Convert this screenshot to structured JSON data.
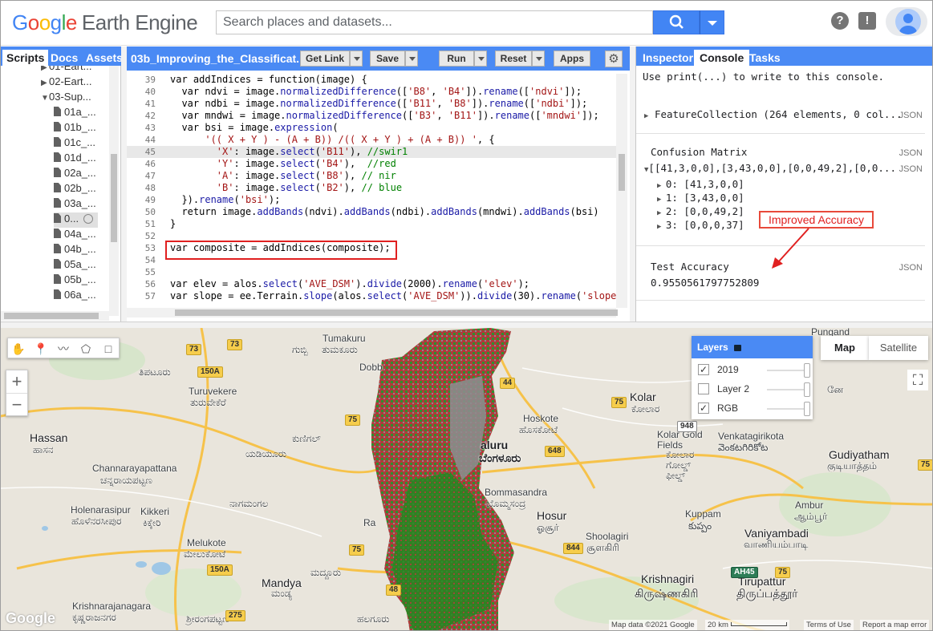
{
  "header": {
    "logo_google": [
      "G",
      "o",
      "o",
      "g",
      "l",
      "e"
    ],
    "logo_product": "Earth Engine",
    "search_placeholder": "Search places and datasets..."
  },
  "left_panel": {
    "tabs": [
      "Scripts",
      "Docs",
      "Assets"
    ],
    "tree": [
      {
        "label": "01-Eart...",
        "type": "folder",
        "expanded": false
      },
      {
        "label": "02-Eart...",
        "type": "folder",
        "expanded": false
      },
      {
        "label": "03-Sup...",
        "type": "folder",
        "expanded": true
      },
      {
        "label": "01a_...",
        "type": "file"
      },
      {
        "label": "01b_...",
        "type": "file"
      },
      {
        "label": "01c_...",
        "type": "file"
      },
      {
        "label": "01d_...",
        "type": "file"
      },
      {
        "label": "02a_...",
        "type": "file"
      },
      {
        "label": "02b_...",
        "type": "file"
      },
      {
        "label": "03a_...",
        "type": "file"
      },
      {
        "label": "0...",
        "type": "file",
        "selected": true
      },
      {
        "label": "04a_...",
        "type": "file"
      },
      {
        "label": "04b_...",
        "type": "file"
      },
      {
        "label": "05a_...",
        "type": "file"
      },
      {
        "label": "05b_...",
        "type": "file"
      },
      {
        "label": "06a_...",
        "type": "file"
      }
    ]
  },
  "editor": {
    "title": "03b_Improving_the_Classificat...",
    "buttons": {
      "get_link": "Get Link",
      "save": "Save",
      "run": "Run",
      "reset": "Reset",
      "apps": "Apps"
    },
    "lines": [
      {
        "n": "39",
        "html": "<span class=\"kw\">var</span> addIndices = <span class=\"kw\">function</span>(image) {"
      },
      {
        "n": "40",
        "html": "  <span class=\"kw\">var</span> ndvi = image.<span class=\"fn\">normalizedDifference</span>([<span class=\"str\">'B8'</span>, <span class=\"str\">'B4'</span>]).<span class=\"fn\">rename</span>([<span class=\"str\">'ndvi'</span>]);"
      },
      {
        "n": "41",
        "html": "  <span class=\"kw\">var</span> ndbi = image.<span class=\"fn\">normalizedDifference</span>([<span class=\"str\">'B11'</span>, <span class=\"str\">'B8'</span>]).<span class=\"fn\">rename</span>([<span class=\"str\">'ndbi'</span>]);"
      },
      {
        "n": "42",
        "html": "  <span class=\"kw\">var</span> mndwi = image.<span class=\"fn\">normalizedDifference</span>([<span class=\"str\">'B3'</span>, <span class=\"str\">'B11'</span>]).<span class=\"fn\">rename</span>([<span class=\"str\">'mndwi'</span>]);"
      },
      {
        "n": "43",
        "html": "  <span class=\"kw\">var</span> bsi = image.<span class=\"fn\">expression</span>("
      },
      {
        "n": "44",
        "html": "      <span class=\"str\">'(( X + Y ) - (A + B)) /(( X + Y ) + (A + B)) '</span>, {"
      },
      {
        "n": "45",
        "html": "        <span class=\"str\">'X'</span>: image.<span class=\"fn\">select</span>(<span class=\"str\">'B11'</span>), <span class=\"cm\">//swir1</span>",
        "hl": true
      },
      {
        "n": "46",
        "html": "        <span class=\"str\">'Y'</span>: image.<span class=\"fn\">select</span>(<span class=\"str\">'B4'</span>),  <span class=\"cm\">//red</span>"
      },
      {
        "n": "47",
        "html": "        <span class=\"str\">'A'</span>: image.<span class=\"fn\">select</span>(<span class=\"str\">'B8'</span>), <span class=\"cm\">// nir</span>"
      },
      {
        "n": "48",
        "html": "        <span class=\"str\">'B'</span>: image.<span class=\"fn\">select</span>(<span class=\"str\">'B2'</span>), <span class=\"cm\">// blue</span>"
      },
      {
        "n": "49",
        "html": "  }).<span class=\"fn\">rename</span>(<span class=\"str\">'bsi'</span>);"
      },
      {
        "n": "50",
        "html": "  <span class=\"kw\">return</span> image.<span class=\"fn\">addBands</span>(ndvi).<span class=\"fn\">addBands</span>(ndbi).<span class=\"fn\">addBands</span>(mndwi).<span class=\"fn\">addBands</span>(bsi)"
      },
      {
        "n": "51",
        "html": "}"
      },
      {
        "n": "52",
        "html": ""
      },
      {
        "n": "53",
        "html": "<span class=\"kw\">var</span> composite = addIndices(composite);"
      },
      {
        "n": "54",
        "html": ""
      },
      {
        "n": "55",
        "html": ""
      },
      {
        "n": "56",
        "html": "<span class=\"kw\">var</span> elev = alos.<span class=\"fn\">select</span>(<span class=\"str\">'AVE_DSM'</span>).<span class=\"fn\">divide</span>(2000).<span class=\"fn\">rename</span>(<span class=\"str\">'elev'</span>);"
      },
      {
        "n": "57",
        "html": "<span class=\"kw\">var</span> slope = ee.Terrain.<span class=\"fn\">slope</span>(alos.<span class=\"fn\">select</span>(<span class=\"str\">'AVE_DSM'</span>)).<span class=\"fn\">divide</span>(30).<span class=\"fn\">rename</span>(<span class=\"str\">'slope'</span>"
      }
    ]
  },
  "console": {
    "tabs": [
      "Inspector",
      "Console",
      "Tasks"
    ],
    "hint": "Use print(...) to write to this console.",
    "json_label": "JSON",
    "feature_collection": "FeatureCollection (264 elements, 0 col...",
    "confusion_title": "Confusion Matrix",
    "confusion_summary": "[[41,3,0,0],[3,43,0,0],[0,0,49,2],[0,0...",
    "confusion_rows": [
      "0: [41,3,0,0]",
      "1: [3,43,0,0]",
      "2: [0,0,49,2]",
      "3: [0,0,0,37]"
    ],
    "accuracy_title": "Test Accuracy",
    "accuracy_value": "0.9550561797752809",
    "callout": "Improved Accuracy"
  },
  "map": {
    "layers_title": "Layers",
    "layers": [
      {
        "name": "2019",
        "checked": true
      },
      {
        "name": "Layer 2",
        "checked": false
      },
      {
        "name": "RGB",
        "checked": true
      }
    ],
    "map_types": [
      "Map",
      "Satellite"
    ],
    "places": [
      {
        "id": "tumakuru",
        "name": "Tumakuru",
        "native": "ತುಮಕೂರು"
      },
      {
        "id": "gubbi",
        "name": "ಗುಬ್ಬಿ"
      },
      {
        "id": "tiptur",
        "name": "ತಿಪಟೂರು"
      },
      {
        "id": "turuvekere",
        "name": "Turuvekere",
        "native": "ತುರುವೇಕೆರೆ"
      },
      {
        "id": "kunigal",
        "name": "ಕುಣಿಗಲ್"
      },
      {
        "id": "yadiyur",
        "name": "ಯಡಿಯೂರು"
      },
      {
        "id": "hassan",
        "name": "Hassan",
        "native": "ಹಾಸನ"
      },
      {
        "id": "channarayapatna",
        "name": "Channarayapattana",
        "native": "ಚನ್ನರಾಯಪಟ್ಟಣ"
      },
      {
        "id": "holenarasipur",
        "name": "Holenarasipur",
        "native": "ಹೊಳೆನರಸೀಪುರ"
      },
      {
        "id": "kikkeri",
        "name": "Kikkeri",
        "native": "ಕಿಕ್ಕೇರಿ"
      },
      {
        "id": "nagamangala",
        "name": "ನಾಗಮಂಗಲ"
      },
      {
        "id": "melukote",
        "name": "Melukote",
        "native": "ಮೇಲುಕೋಟೆ"
      },
      {
        "id": "maddur",
        "name": "ಮದ್ದೂರು"
      },
      {
        "id": "mandya",
        "name": "Mandya",
        "native": "ಮಂಡ್ಯ"
      },
      {
        "id": "krishnarajanagara",
        "name": "Krishnarajanagara",
        "native": "ಕೃಷ್ಣರಾಜನಗರ"
      },
      {
        "id": "srirangapatna",
        "name": "ಶ್ರೀರಂಗಪಟ್ಟಣ"
      },
      {
        "id": "halaguru",
        "name": "ಹಲಗೂರು"
      },
      {
        "id": "dobb",
        "name": "Dobb"
      },
      {
        "id": "bengaluru",
        "name": "aluru",
        "native": "ಬೆಂಗಳೂರು"
      },
      {
        "id": "hoskote",
        "name": "Hoskote",
        "native": "ಹೊಸಕೋಟೆ"
      },
      {
        "id": "bommasandra",
        "name": "Bommasandra",
        "native": "ಬೊಮ್ಮಸಂದ್ರ"
      },
      {
        "id": "hosur",
        "name": "Hosur",
        "native": "ஓசூர்"
      },
      {
        "id": "shoolagiri",
        "name": "Shoolagiri",
        "native": "சூளகிரி"
      },
      {
        "id": "ra",
        "name": "Ra"
      },
      {
        "id": "kolar",
        "name": "Kolar",
        "native": "ಕೋಲಾರ"
      },
      {
        "id": "kolargold",
        "name": "Kolar Gold Fields",
        "native": "ಕೋಲಾರ ಗೋಲ್ಡ್ ಫೀಲ್ಡ್"
      },
      {
        "id": "venkatagiri",
        "name": "Venkatagirikota",
        "native": "వెంకటగిరికోట"
      },
      {
        "id": "gudiyatham",
        "name": "Gudiyatham",
        "native": "குடியாத்தம்"
      },
      {
        "id": "kuppam",
        "name": "Kuppam",
        "native": "కుప్పం"
      },
      {
        "id": "ambur",
        "name": "Ambur",
        "native": "ஆம்பூர்"
      },
      {
        "id": "vaniyambadi",
        "name": "Vaniyambadi",
        "native": "வாணியம்பாடி"
      },
      {
        "id": "krishnagiri",
        "name": "Krishnagiri",
        "native": "கிருஷ்ணகிரி"
      },
      {
        "id": "tirupattur",
        "name": "Tirupattur",
        "native": "திருப்பத்தூர்"
      },
      {
        "id": "pungand",
        "name": "Pungand"
      },
      {
        "id": "vellore",
        "name": "னே"
      }
    ],
    "roads": [
      "73",
      "73",
      "150A",
      "75",
      "44",
      "75",
      "648",
      "75",
      "75",
      "48",
      "275",
      "150A",
      "844",
      "AH45",
      "75",
      "948"
    ],
    "attribution": {
      "data": "Map data ©2021 Google",
      "scale": "20 km",
      "terms": "Terms of Use",
      "report": "Report a map error"
    },
    "google_logo": "Google"
  }
}
